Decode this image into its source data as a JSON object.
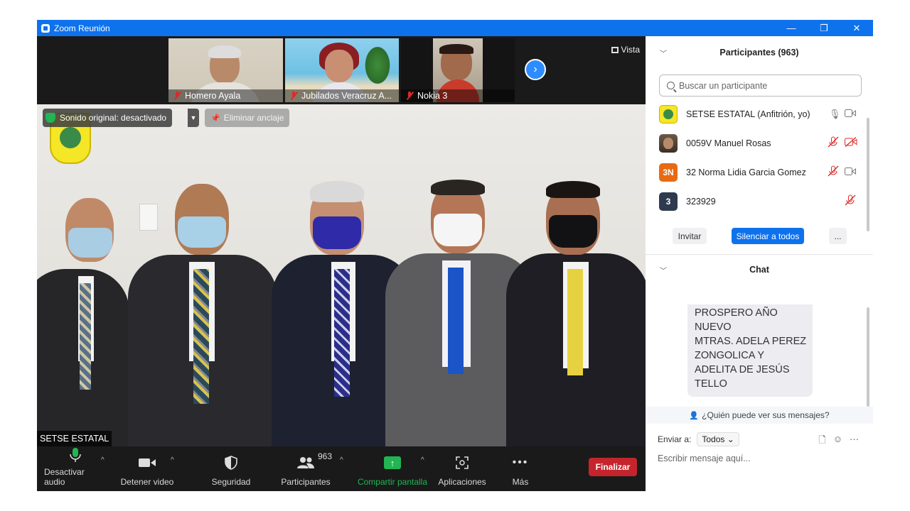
{
  "window": {
    "title": "Zoom Reunión",
    "minimize": "—",
    "restore": "❐",
    "close": "✕"
  },
  "strip": {
    "thumbnails": [
      {
        "name": "Homero Ayala"
      },
      {
        "name": "Jubilados Veracruz A..."
      },
      {
        "name": "Nokia 3"
      }
    ],
    "view_label": "Vista",
    "next_icon": "chevron-right-icon"
  },
  "main_video": {
    "original_sound": "Sonido original: desactivado",
    "unpin_label": "Eliminar anclaje",
    "speaker_name": "SETSE ESTATAL"
  },
  "toolbar": {
    "mute_label": "Desactivar audio",
    "video_label": "Detener video",
    "security_label": "Seguridad",
    "participants_label": "Participantes",
    "participants_count": "963",
    "share_label": "Compartir pantalla",
    "apps_label": "Aplicaciones",
    "more_label": "Más",
    "end_label": "Finalizar",
    "share_color": "#21b553",
    "end_color": "#c4252c"
  },
  "participants_panel": {
    "title": "Participantes (963)",
    "search_placeholder": "Buscar un participante",
    "participants": [
      {
        "name": "SETSE ESTATAL (Anfitrión, yo)",
        "avatar_text": "",
        "mic": "on",
        "video": "on"
      },
      {
        "name": "0059V Manuel Rosas",
        "avatar_text": "",
        "mic": "muted",
        "video": "off"
      },
      {
        "name": "32 Norma Lidia Garcia Gomez",
        "avatar_text": "3N",
        "mic": "muted",
        "video": "on"
      },
      {
        "name": "323929",
        "avatar_text": "3",
        "mic": "muted",
        "video": "none"
      }
    ],
    "invite_label": "Invitar",
    "mute_all_label": "Silenciar a todos",
    "more_label": "..."
  },
  "chat_panel": {
    "title": "Chat",
    "message_lines": [
      "PROSPERO AÑO",
      "NUEVO",
      "MTRAS. ADELA PEREZ",
      "ZONGOLICA Y",
      "ADELITA DE JESÚS",
      "TELLO"
    ],
    "who_can_see": "¿Quién puede ver sus mensajes?",
    "send_to_label": "Enviar a:",
    "send_to_value": "Todos",
    "input_placeholder": "Escribir mensaje aquí...",
    "accent_color": "#0e72ed"
  }
}
